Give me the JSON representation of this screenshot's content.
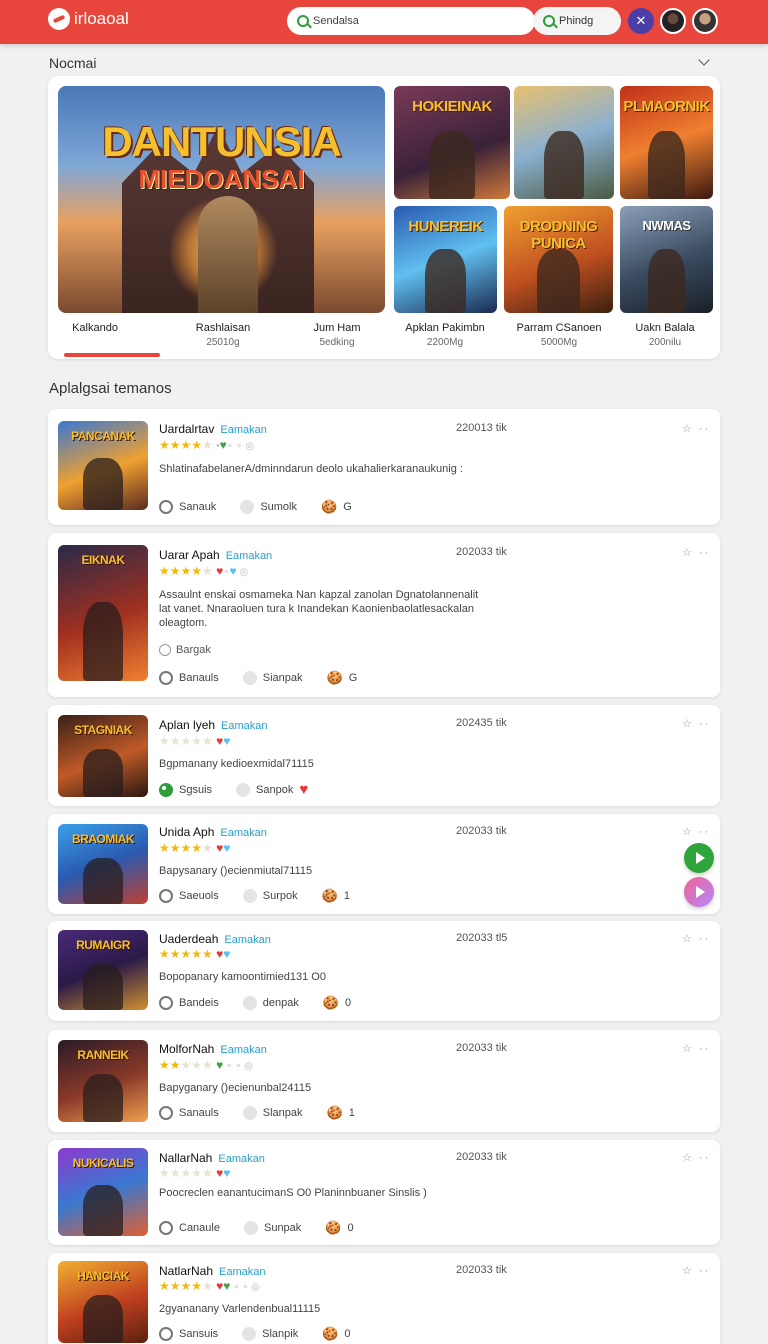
{
  "header": {
    "logo_text": "irloaoal",
    "search_value": "Sendalsa",
    "search_button": "Phindg"
  },
  "featured_section": {
    "title": "Nocmai",
    "hero": {
      "title_line1": "DANTUNSIA",
      "title_line2": "MIEDOANSAI"
    },
    "tiles": [
      "HOKIEINAK",
      "",
      "PLMAORNIK",
      "HUNEREIK",
      "DRODNING PUNICA",
      "NWMAS"
    ],
    "items": [
      {
        "label": "Kalkando",
        "sub": ""
      },
      {
        "label": "Rashlaisan",
        "sub": "25010g"
      },
      {
        "label": "Jum Ham",
        "sub": "5edking"
      },
      {
        "label": "Apklan Pakimbn",
        "sub": "2200Mg"
      },
      {
        "label": "Parram CSanoen",
        "sub": "5000Mg"
      },
      {
        "label": "Uakn Balala",
        "sub": "200nilu"
      }
    ]
  },
  "list_section": {
    "title": "Aplalgsai temanos",
    "tag": "Eamakan",
    "apps": [
      {
        "name": "Uardalrtav",
        "thumb": "PANCANAK",
        "stars": 4,
        "date": "220013 tik",
        "desc": "ShlatinafabelanerA/dminndarun deolo ukahalierkaranaukunig :",
        "extra": "",
        "meta1": "Sanauk",
        "meta2": "Sumolk",
        "meta3": "G"
      },
      {
        "name": "Uarar Apah",
        "thumb": "EIKNAK",
        "stars": 4,
        "date": "202033 tik",
        "desc": "Assaulnt enskai osmameka Nan kapzal zanolan Dgnatolannenalit lat vanet. Nnaraoluen tura k Inandekan Kaonienbaolatlesackalan oleagtom.",
        "extra": "Bargak",
        "meta1": "Banauls",
        "meta2": "Sianpak",
        "meta3": "G"
      },
      {
        "name": "Aplan lyeh",
        "thumb": "STAGNIAK",
        "stars": 0,
        "date": "202435 tik",
        "desc": "Bgpmanany kedioexmidal71115",
        "extra": "",
        "meta1": "Sgsuis",
        "meta2": "Sanpok",
        "meta3": ""
      },
      {
        "name": "Unida Aph",
        "thumb": "BRAOMIAK",
        "stars": 4,
        "date": "202033 tik",
        "desc": "Bapysanary ()ecienmiutal71115",
        "extra": "",
        "meta1": "Saeuols",
        "meta2": "Surpok",
        "meta3": "1"
      },
      {
        "name": "Uaderdeah",
        "thumb": "RUMAIGR",
        "stars": 5,
        "date": "202033 tl5",
        "desc": "Bopopanary kamoontimied131 O0",
        "extra": "",
        "meta1": "Bandeis",
        "meta2": "denpak",
        "meta3": "0"
      },
      {
        "name": "MolforNah",
        "thumb": "RANNEIK",
        "stars": 2,
        "date": "202033 tik",
        "desc": "Bapyganary ()ecienunbal24115",
        "extra": "",
        "meta1": "Sanauls",
        "meta2": "Slanpak",
        "meta3": "1"
      },
      {
        "name": "NallarNah",
        "thumb": "NUKICALIS",
        "stars": 0,
        "date": "202033 tik",
        "desc": "Poocreclen eanantucimanS O0 Planinnbuaner Sinslis )",
        "extra": "",
        "meta1": "Canaule",
        "meta2": "Sunpak",
        "meta3": "0"
      },
      {
        "name": "NatlarNah",
        "thumb": "HANCIAK",
        "stars": 4,
        "date": "202033 tik",
        "desc": "2gyananany Varlendenbual11115",
        "extra": "",
        "meta1": "Sansuis",
        "meta2": "Slanpik",
        "meta3": "0"
      }
    ]
  },
  "colors": {
    "brand": "#e8453c",
    "accent_tag": "#28a0c8",
    "star": "#f2b90d"
  }
}
